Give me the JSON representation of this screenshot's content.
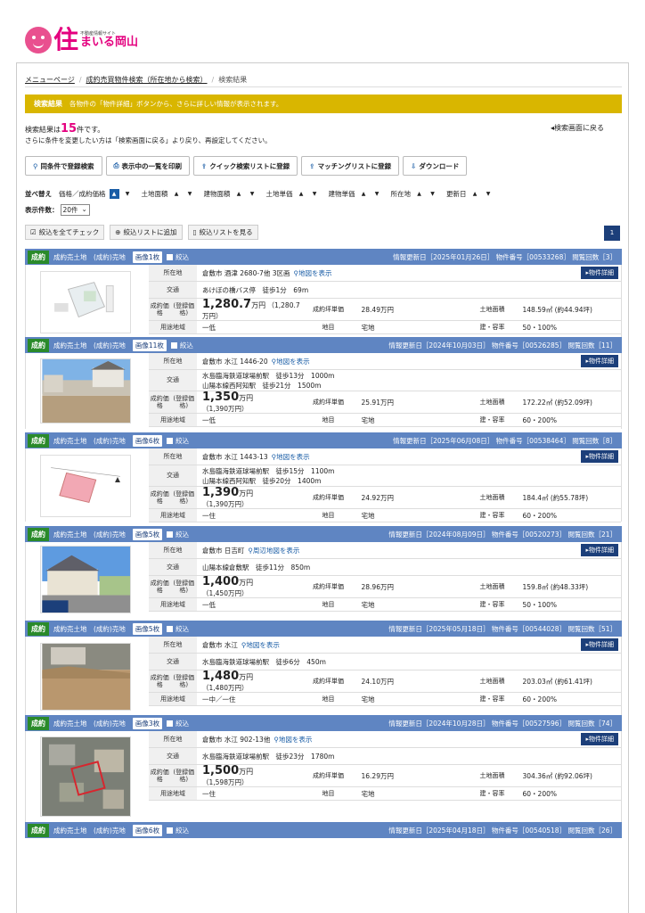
{
  "logo": {
    "small": "不動産情報サイト",
    "char": "住",
    "name": "まいる岡山"
  },
  "breadcrumb": [
    "メニューページ",
    "成約売買物件検索（所在地から検索）",
    "検索結果"
  ],
  "notice": {
    "title": "検索結果",
    "text": "各物件の「物件詳細」ボタンから、さらに詳しい情報が表示されます。"
  },
  "result": {
    "prefix": "検索結果は",
    "count": "15",
    "suffix": "件です。",
    "sub": "さらに条件を変更したい方は「検索画面に戻る」より戻り、再設定してください。"
  },
  "back_label": "検索画面に戻る",
  "toolbar": [
    "同条件で登録検索",
    "表示中の一覧を印刷",
    "クイック検索リストに登録",
    "マッチングリストに登録",
    "ダウンロード"
  ],
  "sort": {
    "title": "並べ替え",
    "keys": [
      "価格／成約価格",
      "土地面積",
      "建物面積",
      "土地単価",
      "建物単価",
      "所在地",
      "更新日"
    ]
  },
  "perpage": {
    "label": "表示件数：",
    "value": "20件"
  },
  "actions": [
    "絞込を全てチェック",
    "絞込リストに追加",
    "絞込リストを見る"
  ],
  "page": "1",
  "labels": {
    "address": "所在地",
    "traffic": "交通",
    "price": "成約価格",
    "price2": "(登録価格)",
    "unitprice": "成約坪単価",
    "land": "土地面積",
    "use": "用途地域",
    "category": "地目",
    "ratio": "建・容率",
    "detail": "物件詳細",
    "filter": "絞込",
    "badge": "成約"
  },
  "listings": [
    {
      "type": "成約売土地　(成約)売地",
      "imgs": "画像1枚",
      "updated": "情報更新日［2025年01月26日］ 物件番号［00533268］ 閲覧回数［3］",
      "address": "倉敷市 酒津 2680-7他 3区画",
      "map": "地図を表示",
      "traffic": [
        "あけぼの橋バス停　徒歩1分　69m"
      ],
      "price": "1,280.7",
      "price_unit": "万円",
      "reg_price": "（1,280.7万円）",
      "unit_price": "28.49万円",
      "land": "148.59㎡ (約44.94坪)",
      "use": "一低",
      "category": "宅地",
      "ratio": "50・100%"
    },
    {
      "type": "成約売土地　(成約)売地",
      "imgs": "画像11枚",
      "updated": "情報更新日［2024年10月03日］ 物件番号［00526285］ 閲覧回数［11］",
      "address": "倉敷市 水江 1446-20",
      "map": "地図を表示",
      "traffic": [
        "水島臨海鉄道球場前駅　徒歩13分　1000m",
        "山陽本線西阿知駅　徒歩21分　1500m"
      ],
      "price": "1,350",
      "price_unit": "万円",
      "reg_price": "（1,390万円）",
      "unit_price": "25.91万円",
      "land": "172.22㎡ (約52.09坪)",
      "use": "一低",
      "category": "宅地",
      "ratio": "60・200%"
    },
    {
      "type": "成約売土地　(成約)売地",
      "imgs": "画像6枚",
      "updated": "情報更新日［2025年06月08日］ 物件番号［00538464］ 閲覧回数［8］",
      "address": "倉敷市 水江 1443-13",
      "map": "地図を表示",
      "traffic": [
        "水島臨海鉄道球場前駅　徒歩15分　1100m",
        "山陽本線西阿知駅　徒歩20分　1400m"
      ],
      "price": "1,390",
      "price_unit": "万円",
      "reg_price": "（1,390万円）",
      "unit_price": "24.92万円",
      "land": "184.4㎡ (約55.78坪)",
      "use": "一住",
      "category": "宅地",
      "ratio": "60・200%"
    },
    {
      "type": "成約売土地　(成約)売地",
      "imgs": "画像5枚",
      "updated": "情報更新日［2024年08月09日］ 物件番号［00520273］ 閲覧回数［21］",
      "address": "倉敷市 日吉町",
      "map": "周辺地図を表示",
      "traffic": [
        "山陽本線倉敷駅　徒歩11分　850m"
      ],
      "price": "1,400",
      "price_unit": "万円",
      "reg_price": "（1,450万円）",
      "unit_price": "28.96万円",
      "land": "159.8㎡ (約48.33坪)",
      "use": "一低",
      "category": "宅地",
      "ratio": "50・100%"
    },
    {
      "type": "成約売土地　(成約)売地",
      "imgs": "画像5枚",
      "updated": "情報更新日［2025年05月18日］ 物件番号［00544028］ 閲覧回数［51］",
      "address": "倉敷市 水江",
      "map": "地図を表示",
      "traffic": [
        "水島臨海鉄道球場前駅　徒歩6分　450m"
      ],
      "price": "1,480",
      "price_unit": "万円",
      "reg_price": "（1,480万円）",
      "unit_price": "24.10万円",
      "land": "203.03㎡ (約61.41坪)",
      "use": "一中／一住",
      "category": "宅地",
      "ratio": "60・200%"
    },
    {
      "type": "成約売土地　(成約)売地",
      "imgs": "画像3枚",
      "updated": "情報更新日［2024年10月28日］ 物件番号［00527596］ 閲覧回数［74］",
      "address": "倉敷市 水江 902-13他",
      "map": "地図を表示",
      "traffic": [
        "水島臨海鉄道球場前駅　徒歩23分　1780m"
      ],
      "price": "1,500",
      "price_unit": "万円",
      "reg_price": "（1,598万円）",
      "unit_price": "16.29万円",
      "land": "304.36㎡ (約92.06坪)",
      "use": "一住",
      "category": "宅地",
      "ratio": "60・200%"
    }
  ],
  "last_header": {
    "type": "成約売土地　(成約)売地",
    "imgs": "画像6枚",
    "updated": "情報更新日［2025年04月18日］ 物件番号［00540518］ 閲覧回数［26］"
  },
  "thumb4_label": "HOUSEDO"
}
